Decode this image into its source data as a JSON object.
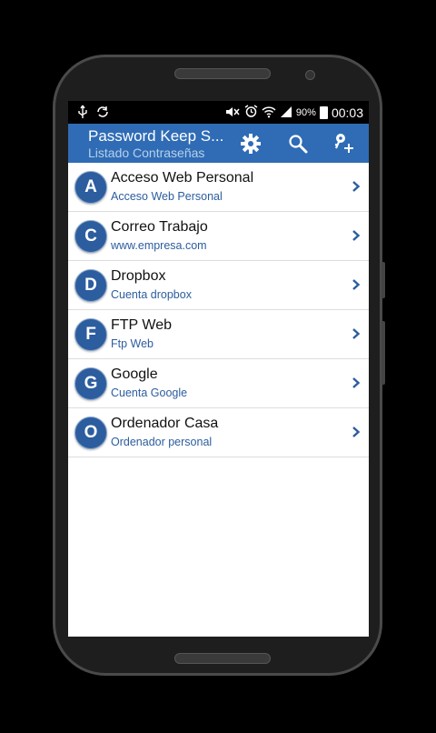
{
  "statusbar": {
    "battery_pct": "90%",
    "time": "00:03"
  },
  "actionbar": {
    "title": "Password Keep S...",
    "subtitle": "Listado Contraseñas"
  },
  "items": [
    {
      "letter": "A",
      "title": "Acceso Web Personal",
      "subtitle": "Acceso Web Personal"
    },
    {
      "letter": "C",
      "title": "Correo Trabajo",
      "subtitle": "www.empresa.com"
    },
    {
      "letter": "D",
      "title": "Dropbox",
      "subtitle": "Cuenta dropbox"
    },
    {
      "letter": "F",
      "title": "FTP Web",
      "subtitle": "Ftp Web"
    },
    {
      "letter": "G",
      "title": "Google",
      "subtitle": "Cuenta Google"
    },
    {
      "letter": "O",
      "title": "Ordenador Casa",
      "subtitle": "Ordenador personal"
    }
  ],
  "colors": {
    "actionbar": "#2f6cb5",
    "accent": "#2c5d9e"
  }
}
